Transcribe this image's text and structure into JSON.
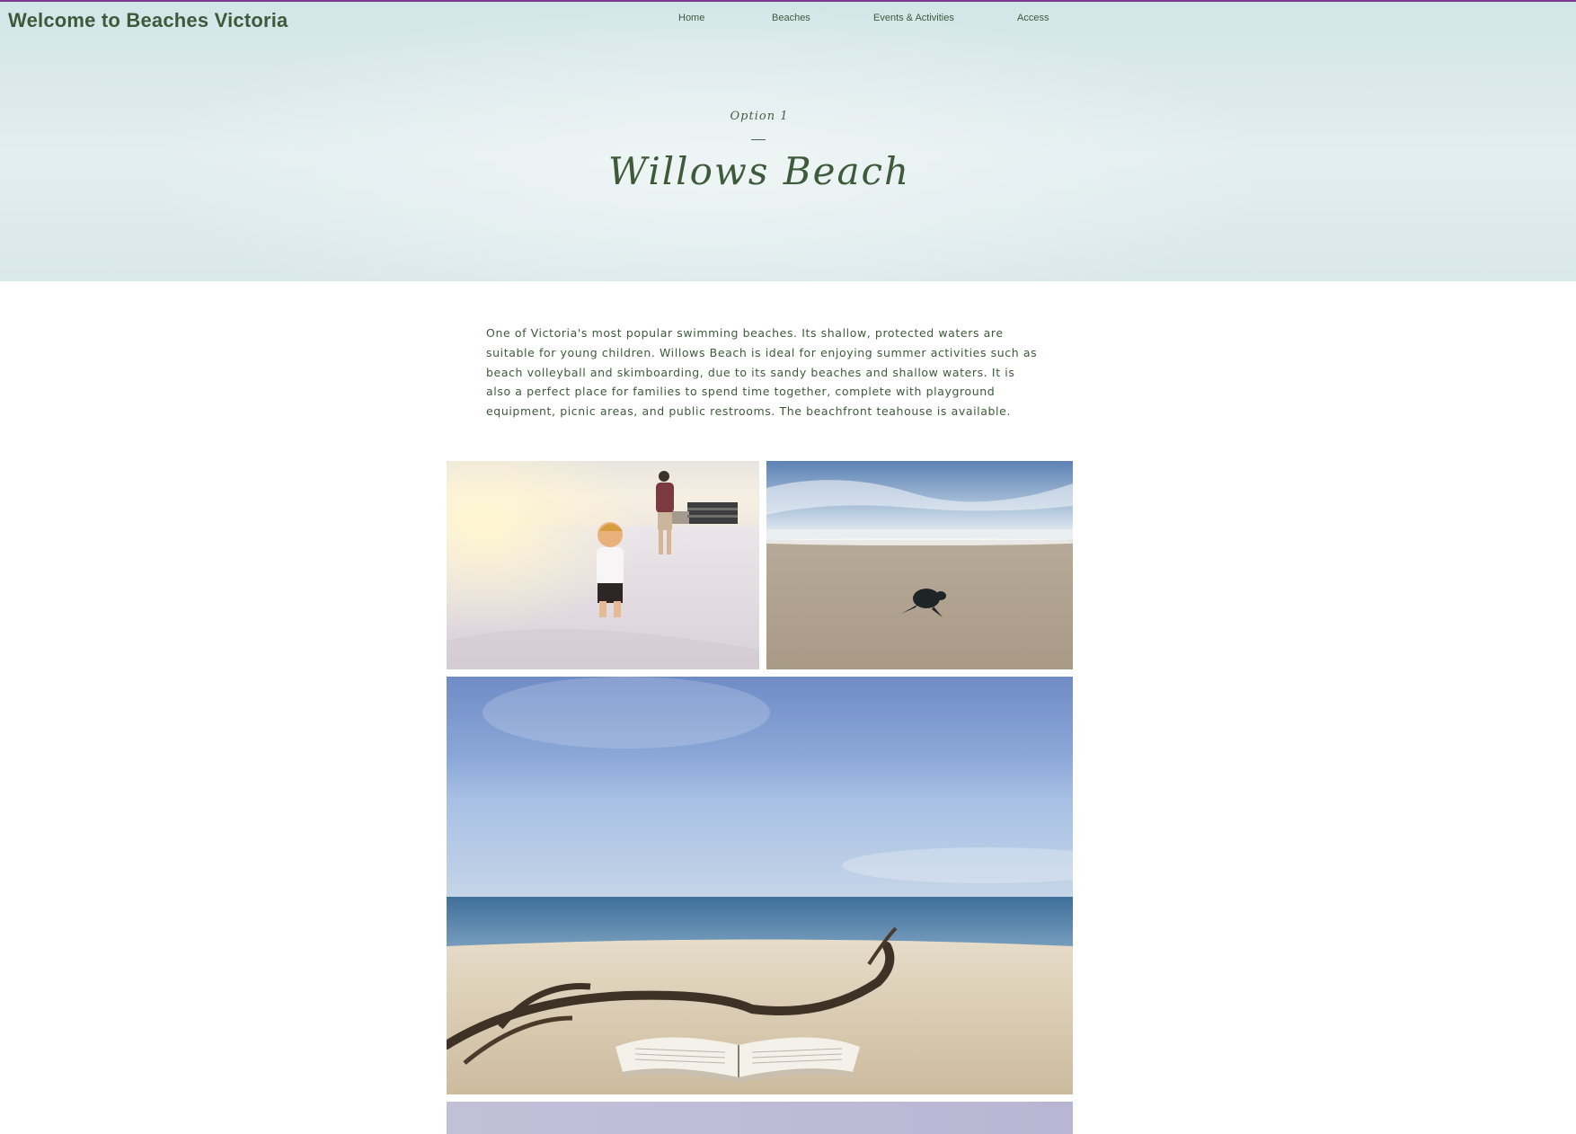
{
  "site": {
    "title": "Welcome to Beaches Victoria"
  },
  "nav": {
    "items": [
      {
        "label": "Home"
      },
      {
        "label": "Beaches"
      },
      {
        "label": "Events & Activities"
      },
      {
        "label": "Access"
      }
    ]
  },
  "hero": {
    "subtitle": "Option 1",
    "title": "Willows Beach"
  },
  "intro": {
    "text": "One of Victoria's most popular swimming beaches. Its shallow, protected waters are suitable for young children. Willows Beach is ideal for enjoying summer activities such as beach volleyball and skimboarding, due to its sandy beaches and shallow waters.  It is also a perfect place for families to spend time together, complete with playground equipment, picnic areas, and public restrooms. The beachfront teahouse is available."
  },
  "gallery": {
    "images": [
      {
        "subject": "child running on sandy beach with parent"
      },
      {
        "subject": "baby sea turtle on sand"
      },
      {
        "subject": "open book and driftwood on beach"
      },
      {
        "subject": "beach photo (partially visible)"
      }
    ]
  },
  "colors": {
    "accent_green": "#3d5a3a",
    "top_rule": "#7b3a8c",
    "hero_background": "#dbe9eb"
  }
}
